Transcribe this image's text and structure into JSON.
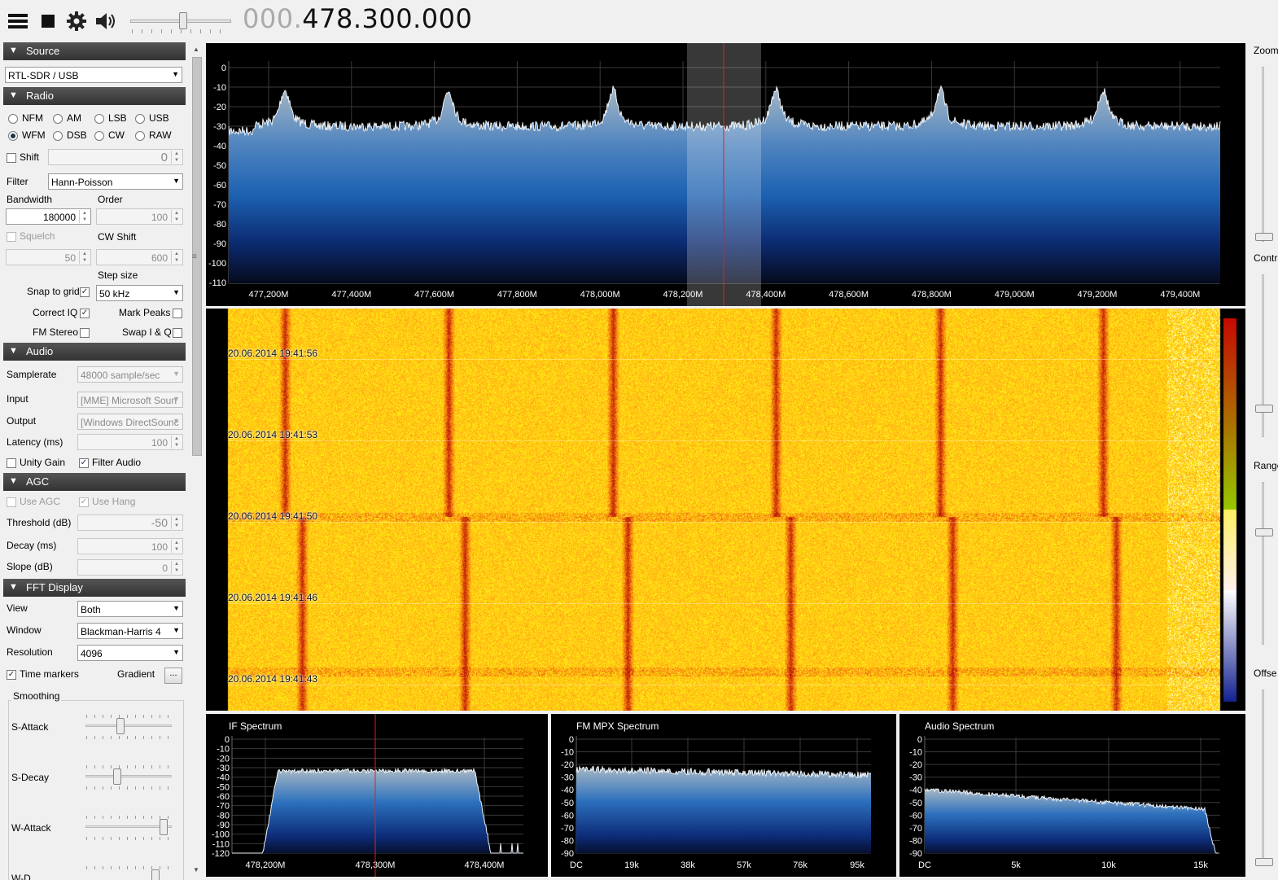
{
  "toolbar": {
    "menu_icon": "hamburger-menu-icon",
    "stop_icon": "stop-icon",
    "settings_icon": "gear-icon",
    "volume_icon": "speaker-icon",
    "volume": 0.5,
    "freq_prefix": "000.",
    "freq_main": "478.300.000"
  },
  "source": {
    "header": "Source",
    "device": "RTL-SDR / USB"
  },
  "radio": {
    "header": "Radio",
    "modes": [
      "NFM",
      "AM",
      "LSB",
      "USB",
      "WFM",
      "DSB",
      "CW",
      "RAW"
    ],
    "selected_mode": "WFM",
    "shift_label": "Shift",
    "shift_value": "0",
    "filter_label": "Filter",
    "filter_value": "Hann-Poisson",
    "bandwidth_label": "Bandwidth",
    "bandwidth_value": "180000",
    "order_label": "Order",
    "order_value": "100",
    "squelch_label": "Squelch",
    "squelch_value": "50",
    "cwshift_label": "CW Shift",
    "cwshift_value": "600",
    "stepsize_label": "Step size",
    "snap_label": "Snap to grid",
    "step_value": "50 kHz",
    "correctiq_label": "Correct IQ",
    "markpeaks_label": "Mark Peaks",
    "fmstereo_label": "FM Stereo",
    "swapiq_label": "Swap I & Q"
  },
  "audio": {
    "header": "Audio",
    "samplerate_label": "Samplerate",
    "samplerate_value": "48000 sample/sec",
    "input_label": "Input",
    "input_value": "[MME] Microsoft Soun",
    "output_label": "Output",
    "output_value": "[Windows DirectSounc",
    "latency_label": "Latency (ms)",
    "latency_value": "100",
    "unitygain_label": "Unity Gain",
    "filteraudio_label": "Filter Audio"
  },
  "agc": {
    "header": "AGC",
    "useagc_label": "Use AGC",
    "usehang_label": "Use Hang",
    "threshold_label": "Threshold (dB)",
    "threshold_value": "-50",
    "decay_label": "Decay (ms)",
    "decay_value": "100",
    "slope_label": "Slope (dB)",
    "slope_value": "0"
  },
  "fft": {
    "header": "FFT Display",
    "view_label": "View",
    "view_value": "Both",
    "window_label": "Window",
    "window_value": "Blackman-Harris 4",
    "resolution_label": "Resolution",
    "resolution_value": "4096",
    "timemarkers_label": "Time markers",
    "gradient_label": "Gradient",
    "gradient_button": "...",
    "smoothing_label": "Smoothing",
    "sattack_label": "S-Attack",
    "sdecay_label": "S-Decay",
    "wattack_label": "W-Attack",
    "wdecay_label": "W-D",
    "sattack": 0.4,
    "sdecay": 0.35,
    "wattack": 0.95
  },
  "right": {
    "zoom_label": "Zoom",
    "contrast_label": "Contra",
    "range_label": "Range",
    "offset_label": "Offse"
  },
  "spectrum": {
    "y_ticks": [
      "0",
      "-10",
      "-20",
      "-30",
      "-40",
      "-50",
      "-60",
      "-70",
      "-80",
      "-90",
      "-100",
      "-110"
    ],
    "x_ticks": [
      "477,200M",
      "477,400M",
      "477,600M",
      "477,800M",
      "478,000M",
      "478,200M",
      "478,400M",
      "478,600M",
      "478,800M",
      "479,000M",
      "479,200M",
      "479,400M"
    ]
  },
  "waterfall": {
    "timestamps": [
      "20.06.2014 19:41:56",
      "20.06.2014 19:41:53",
      "20.06.2014 19:41:50",
      "20.06.2014 19:41:46",
      "20.06.2014 19:41:43"
    ]
  },
  "if_spectrum": {
    "title": "IF Spectrum",
    "y_ticks": [
      "0",
      "-10",
      "-20",
      "-30",
      "-40",
      "-50",
      "-60",
      "-70",
      "-80",
      "-90",
      "-100",
      "-110",
      "-120"
    ],
    "x_ticks": [
      "478,200M",
      "478,300M",
      "478,400M"
    ]
  },
  "mpx_spectrum": {
    "title": "FM MPX Spectrum",
    "y_ticks": [
      "0",
      "-10",
      "-20",
      "-30",
      "-40",
      "-50",
      "-60",
      "-70",
      "-80",
      "-90"
    ],
    "x_ticks": [
      "DC",
      "19k",
      "38k",
      "57k",
      "76k",
      "95k"
    ]
  },
  "audio_spectrum": {
    "title": "Audio Spectrum",
    "y_ticks": [
      "0",
      "-10",
      "-20",
      "-30",
      "-40",
      "-50",
      "-60",
      "-70",
      "-80",
      "-90"
    ],
    "x_ticks": [
      "DC",
      "5k",
      "10k",
      "15k"
    ]
  }
}
